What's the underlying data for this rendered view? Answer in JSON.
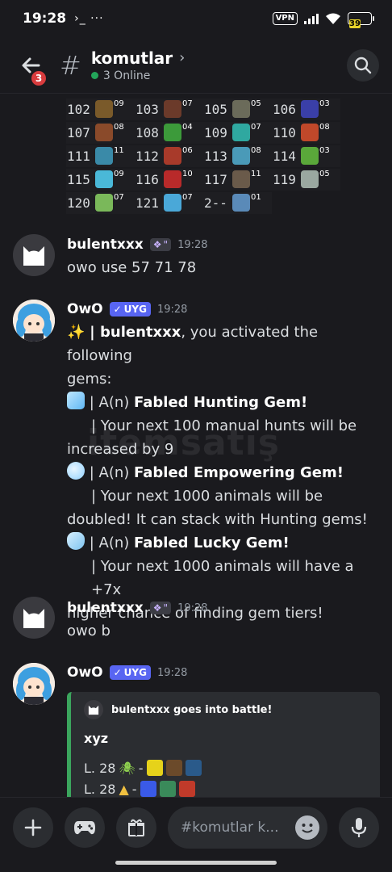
{
  "status_bar": {
    "time": "19:28",
    "left_extra": "›_ ···",
    "vpn": "VPN",
    "battery": "39"
  },
  "header": {
    "unread_count": "3",
    "channel_name": "komutlar",
    "online": "3 Online"
  },
  "gem_grid": [
    [
      {
        "num": "102",
        "count": "09",
        "color": "#7a5a2a"
      },
      {
        "num": "103",
        "count": "07",
        "color": "#6b3a2a"
      },
      {
        "num": "105",
        "count": "05",
        "color": "#6b6b5a"
      },
      {
        "num": "106",
        "count": "03",
        "color": "#3a3fa8"
      }
    ],
    [
      {
        "num": "107",
        "count": "08",
        "color": "#8a4a2a"
      },
      {
        "num": "108",
        "count": "04",
        "color": "#3c9a3a"
      },
      {
        "num": "109",
        "count": "07",
        "color": "#2fa8a0"
      },
      {
        "num": "110",
        "count": "08",
        "color": "#c0482a"
      }
    ],
    [
      {
        "num": "111",
        "count": "11",
        "color": "#3a8aa8"
      },
      {
        "num": "112",
        "count": "06",
        "color": "#a83a2a"
      },
      {
        "num": "113",
        "count": "08",
        "color": "#4a9ab8"
      },
      {
        "num": "114",
        "count": "03",
        "color": "#5aa83a"
      }
    ],
    [
      {
        "num": "115",
        "count": "09",
        "color": "#4ab8d8"
      },
      {
        "num": "116",
        "count": "10",
        "color": "#b82a2a"
      },
      {
        "num": "117",
        "count": "11",
        "color": "#6a5a4a"
      },
      {
        "num": "119",
        "count": "05",
        "color": "#9aa8a0"
      }
    ],
    [
      {
        "num": "120",
        "count": "07",
        "color": "#7ab85a"
      },
      {
        "num": "121",
        "count": "07",
        "color": "#4aa8d8"
      },
      {
        "num": "2--",
        "count": "01",
        "color": "#5a8ab8"
      },
      null
    ]
  ],
  "messages": [
    {
      "author": "bulentxxx",
      "time": "19:28",
      "text": "owo use 57 71 78"
    },
    {
      "author": "OwO",
      "app_tag": "UYG",
      "time": "19:28",
      "lines": {
        "l1_user": "bulentxxx",
        "l1_rest": ", you activated the following",
        "l2": "gems:",
        "g1_prefix": "| A(n) ",
        "g1_name": "Fabled Hunting Gem!",
        "g1_d1": "| Your next 100 manual hunts will be",
        "g1_d2": "increased by 9",
        "g2_prefix": "| A(n) ",
        "g2_name": "Fabled Empowering Gem!",
        "g2_d1": "| Your next 1000 animals will be",
        "g2_d2": "doubled! It can stack with Hunting gems!",
        "g3_prefix": "| A(n) ",
        "g3_name": "Fabled Lucky Gem!",
        "g3_d1": "| Your next 1000 animals will have a +7x",
        "g3_d2": "higher chance of finding gem tiers!"
      }
    },
    {
      "author": "bulentxxx",
      "time": "19:28",
      "text": "owo b"
    },
    {
      "author": "OwO",
      "app_tag": "UYG",
      "time": "19:28",
      "embed": {
        "author": "bulentxxx goes into battle!",
        "title": "xyz",
        "line1": "L. 28",
        "line2": "L. 28",
        "dash": "-"
      }
    }
  ],
  "watermark": "itemsatış",
  "input": {
    "placeholder": "#komutlar k..."
  },
  "colors": {
    "accent": "#5865f2",
    "online": "#23a55a",
    "badge": "#d83c3e",
    "embed_bar": "#3ba55d"
  }
}
